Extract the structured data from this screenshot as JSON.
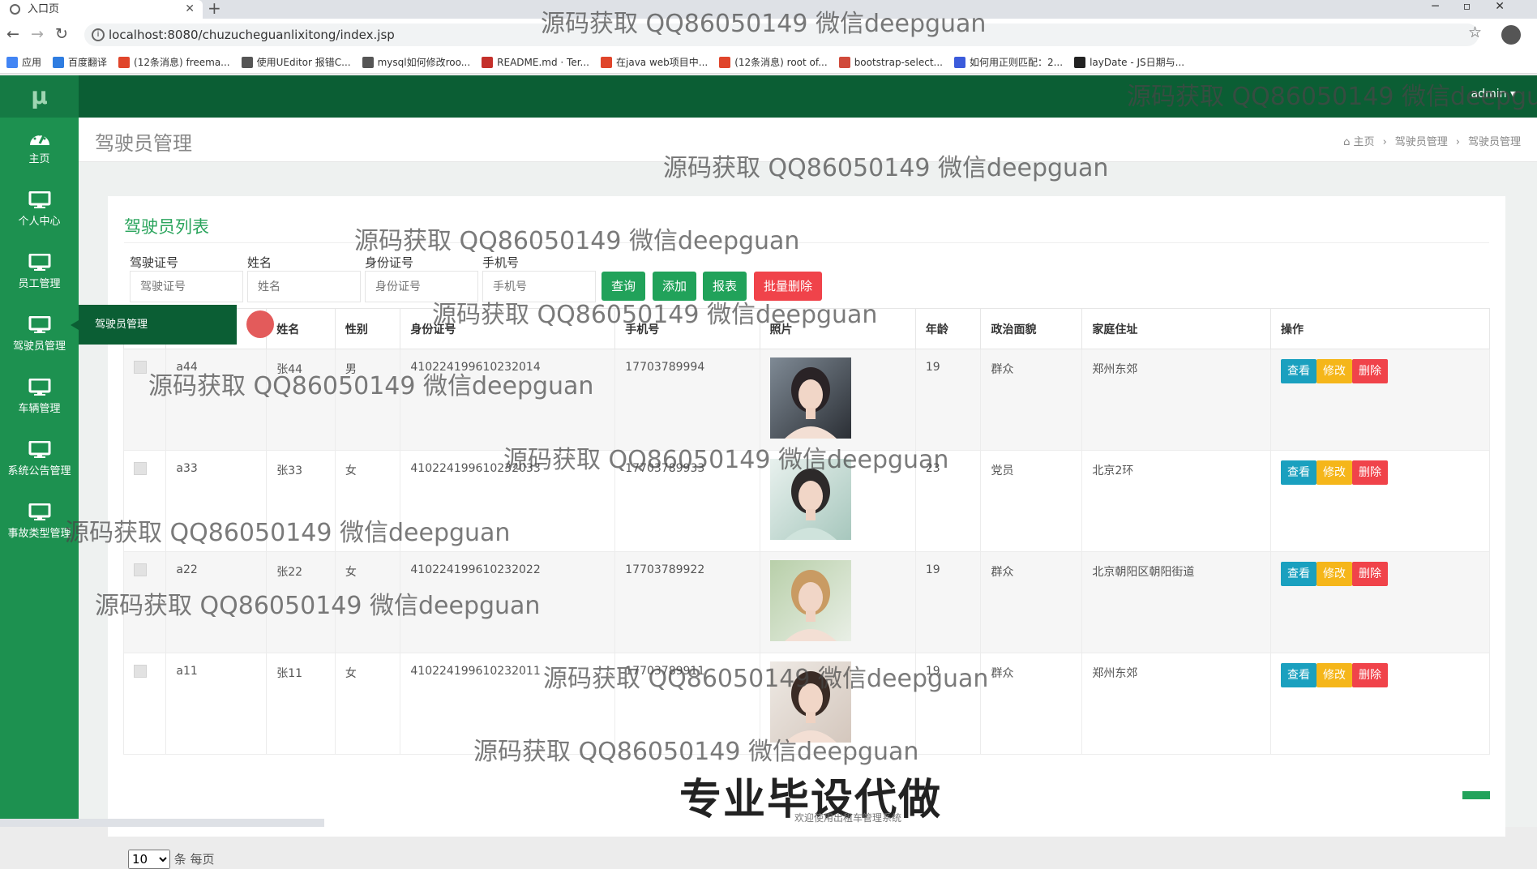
{
  "browser": {
    "tab_title": "入口页",
    "url": "localhost:8080/chuzucheguanlixitong/index.jsp",
    "bookmarks": [
      "应用",
      "百度翻译",
      "(12条消息) freema...",
      "使用UEditor 报错C...",
      "mysql如何修改roo...",
      "README.md · Ter...",
      "在java web项目中...",
      "(12条消息) root of...",
      "bootstrap-select...",
      "如何用正则匹配：2...",
      "layDate - JS日期与..."
    ]
  },
  "topbar": {
    "logo": "μ",
    "user": "admin ▾"
  },
  "sidebar": {
    "items": [
      {
        "label": "主页",
        "icon": "dashboard-icon"
      },
      {
        "label": "个人中心",
        "icon": "monitor-icon"
      },
      {
        "label": "员工管理",
        "icon": "monitor-icon"
      },
      {
        "label": "驾驶员管理",
        "icon": "monitor-icon"
      },
      {
        "label": "车辆管理",
        "icon": "monitor-icon"
      },
      {
        "label": "系统公告管理",
        "icon": "monitor-icon"
      },
      {
        "label": "事故类型管理",
        "icon": "monitor-icon"
      }
    ],
    "flyout": "驾驶员管理"
  },
  "header": {
    "title": "驾驶员管理",
    "breadcrumb": [
      "主页",
      "驾驶员管理",
      "驾驶员管理"
    ]
  },
  "card": {
    "title": "驾驶员列表",
    "filters": [
      {
        "label": "驾驶证号",
        "placeholder": "驾驶证号"
      },
      {
        "label": "姓名",
        "placeholder": "姓名"
      },
      {
        "label": "身份证号",
        "placeholder": "身份证号"
      },
      {
        "label": "手机号",
        "placeholder": "手机号"
      }
    ],
    "buttons": {
      "query": "查询",
      "add": "添加",
      "report": "报表",
      "batch_delete": "批量删除"
    },
    "columns": [
      "",
      "",
      "姓名",
      "性别",
      "身份证号",
      "手机号",
      "照片",
      "年龄",
      "政治面貌",
      "家庭住址",
      "操作"
    ],
    "rows": [
      {
        "license": "a44",
        "name": "张44",
        "gender": "男",
        "id_card": "410224199610232014",
        "phone": "17703789994",
        "age": "19",
        "politics": "群众",
        "address": "郑州东郊"
      },
      {
        "license": "a33",
        "name": "张33",
        "gender": "女",
        "id_card": "410224199610232033",
        "phone": "17703789933",
        "age": "23",
        "politics": "党员",
        "address": "北京2环"
      },
      {
        "license": "a22",
        "name": "张22",
        "gender": "女",
        "id_card": "410224199610232022",
        "phone": "17703789922",
        "age": "19",
        "politics": "群众",
        "address": "北京朝阳区朝阳街道"
      },
      {
        "license": "a11",
        "name": "张11",
        "gender": "女",
        "id_card": "410224199610232011",
        "phone": "17703789911",
        "age": "19",
        "politics": "群众",
        "address": "郑州东郊"
      }
    ],
    "row_actions": {
      "view": "查看",
      "edit": "修改",
      "delete": "删除"
    },
    "pager": {
      "page_size": "10",
      "suffix": "条 每页"
    }
  },
  "watermark": "源码获取 QQ86050149 微信deepguan",
  "banner": "专业毕设代做",
  "footnote": "欢迎使用出租车管理系统"
}
